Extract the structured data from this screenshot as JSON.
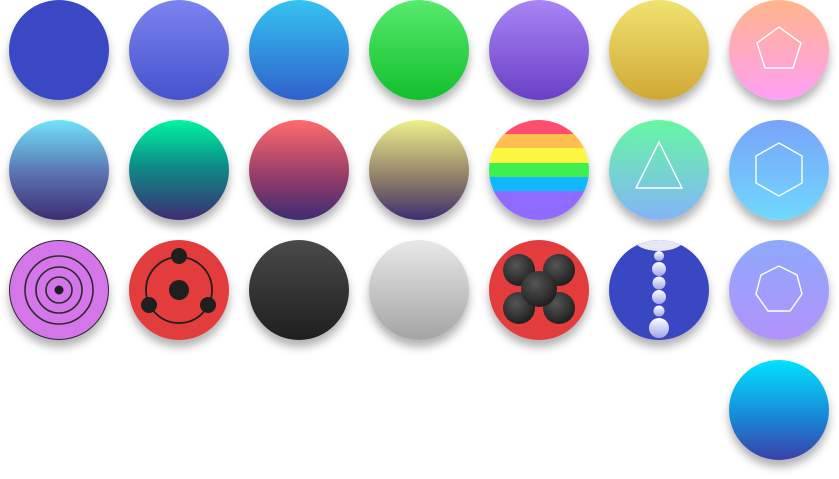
{
  "swatches": [
    {
      "id": "indigo",
      "colors": [
        "#3b48c4"
      ],
      "icon": null
    },
    {
      "id": "periwinkle-gradient",
      "colors": [
        "#7b84ee",
        "#4552cc"
      ],
      "icon": null
    },
    {
      "id": "sky-blue-gradient",
      "colors": [
        "#35c3f0",
        "#3061cc"
      ],
      "icon": null
    },
    {
      "id": "green-gradient",
      "colors": [
        "#58ea6e",
        "#11bf2c"
      ],
      "icon": null
    },
    {
      "id": "violet-gradient",
      "colors": [
        "#a985f5",
        "#6a3fc6"
      ],
      "icon": null
    },
    {
      "id": "mustard-gradient",
      "colors": [
        "#f1e270",
        "#cfa834"
      ],
      "icon": null
    },
    {
      "id": "peach-pink-gradient",
      "colors": [
        "#ffb58a",
        "#ffa0f6"
      ],
      "icon": "pentagon-icon"
    },
    {
      "id": "aqua-dusk-gradient",
      "colors": [
        "#6fe3fa",
        "#3d2d72"
      ],
      "icon": null
    },
    {
      "id": "teal-dusk-gradient",
      "colors": [
        "#00f5a0",
        "#3d2d72"
      ],
      "icon": null
    },
    {
      "id": "coral-dusk-gradient",
      "colors": [
        "#ff6b6b",
        "#3d2d72"
      ],
      "icon": null
    },
    {
      "id": "lemon-dusk-gradient",
      "colors": [
        "#eef08a",
        "#3d2d72"
      ],
      "icon": null
    },
    {
      "id": "rainbow-stripes",
      "colors": [
        "#ff4d6d",
        "#ffbe4d",
        "#faf740",
        "#3df04f",
        "#12b8ff",
        "#8f6cff"
      ],
      "icon": null
    },
    {
      "id": "mint-blue-gradient",
      "colors": [
        "#66f7a4",
        "#84b4f7"
      ],
      "icon": "triangle-icon"
    },
    {
      "id": "icy-blue-gradient",
      "colors": [
        "#79a3fa",
        "#70d8fc"
      ],
      "icon": "hexagon-icon"
    },
    {
      "id": "lilac-rings",
      "colors": [
        "#d476e9",
        "#2b2b2b"
      ],
      "icon": "concentric-rings-icon"
    },
    {
      "id": "red-tomoe",
      "colors": [
        "#e23c3c",
        "#1f1f1f"
      ],
      "icon": "tomoe-icon"
    },
    {
      "id": "charcoal-gradient",
      "colors": [
        "#4a4a4a",
        "#1f1f1f"
      ],
      "icon": null
    },
    {
      "id": "silver-gradient",
      "colors": [
        "#e8e8e8",
        "#a4a4a4"
      ],
      "icon": null
    },
    {
      "id": "red-blob-flower",
      "colors": [
        "#e23c3c",
        "#2a2a2a"
      ],
      "icon": "blob-flower-icon"
    },
    {
      "id": "cobalt-bubbles",
      "colors": [
        "#3a47c2",
        "#ffffff"
      ],
      "icon": "bubbles-icon"
    },
    {
      "id": "lavender-gradient",
      "colors": [
        "#8ea9fb",
        "#b293fb"
      ],
      "icon": "heptagon-icon"
    },
    {
      "id": "ocean-gradient",
      "colors": [
        "#00e2fe",
        "#3b3fa8"
      ],
      "icon": null
    }
  ]
}
